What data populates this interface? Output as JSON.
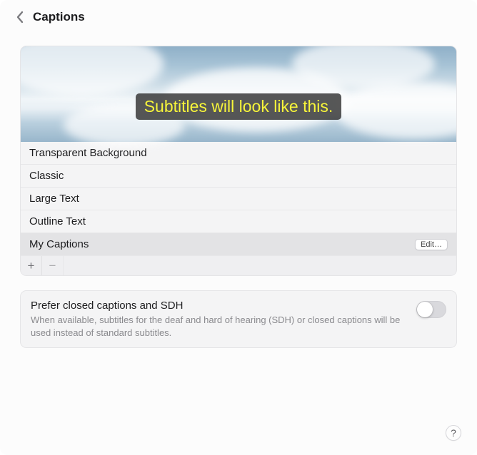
{
  "header": {
    "title": "Captions"
  },
  "preview": {
    "subtitle_text": "Subtitles will look like this."
  },
  "styles": {
    "items": [
      {
        "label": "Transparent Background",
        "selected": false,
        "editable": false
      },
      {
        "label": "Classic",
        "selected": false,
        "editable": false
      },
      {
        "label": "Large Text",
        "selected": false,
        "editable": false
      },
      {
        "label": "Outline Text",
        "selected": false,
        "editable": false
      },
      {
        "label": "My Captions",
        "selected": true,
        "editable": true
      }
    ],
    "edit_label": "Edit…"
  },
  "prefer": {
    "title": "Prefer closed captions and SDH",
    "description": "When available, subtitles for the deaf and hard of hearing (SDH) or closed captions will be used instead of standard subtitles.",
    "enabled": false
  },
  "icons": {
    "plus": "+",
    "minus": "−",
    "help": "?"
  }
}
